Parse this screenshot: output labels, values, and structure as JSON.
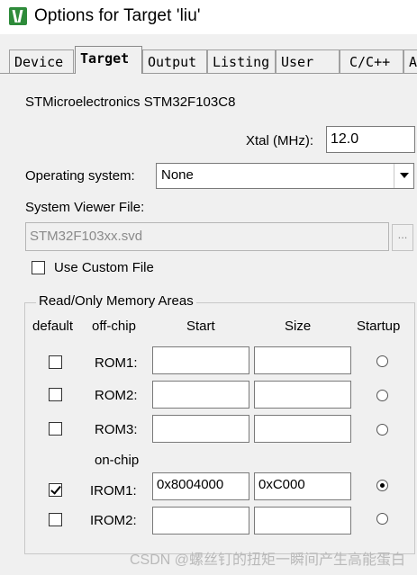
{
  "window": {
    "title": "Options for Target 'liu'",
    "icon": "keil-uvision-icon"
  },
  "tabs": [
    {
      "label": "Device",
      "active": false
    },
    {
      "label": "Target",
      "active": true
    },
    {
      "label": "Output",
      "active": false
    },
    {
      "label": "Listing",
      "active": false
    },
    {
      "label": "User",
      "active": false
    },
    {
      "label": "C/C++",
      "active": false
    },
    {
      "label": "A",
      "active": false
    }
  ],
  "target": {
    "device_name": "STMicroelectronics STM32F103C8",
    "xtal_label": "Xtal (MHz):",
    "xtal_value": "12.0",
    "os_label": "Operating system:",
    "os_value": "None",
    "sv_label": "System Viewer File:",
    "sv_value": "STM32F103xx.svd",
    "browse_label": "...",
    "custom_label": "Use Custom File",
    "custom_checked": false
  },
  "memory": {
    "group_title": "Read/Only Memory Areas",
    "headers": {
      "default": "default",
      "offchip": "off-chip",
      "start": "Start",
      "size": "Size",
      "startup": "Startup"
    },
    "onchip_label": "on-chip",
    "rows": [
      {
        "label": "ROM1:",
        "default": false,
        "start": "",
        "size": "",
        "startup": false
      },
      {
        "label": "ROM2:",
        "default": false,
        "start": "",
        "size": "",
        "startup": false
      },
      {
        "label": "ROM3:",
        "default": false,
        "start": "",
        "size": "",
        "startup": false
      },
      {
        "label": "IROM1:",
        "default": true,
        "start": "0x8004000",
        "size": "0xC000",
        "startup": true
      },
      {
        "label": "IROM2:",
        "default": false,
        "start": "",
        "size": "",
        "startup": false
      }
    ]
  },
  "watermark": "CSDN @螺丝钉的扭矩一瞬间产生高能蛋白"
}
